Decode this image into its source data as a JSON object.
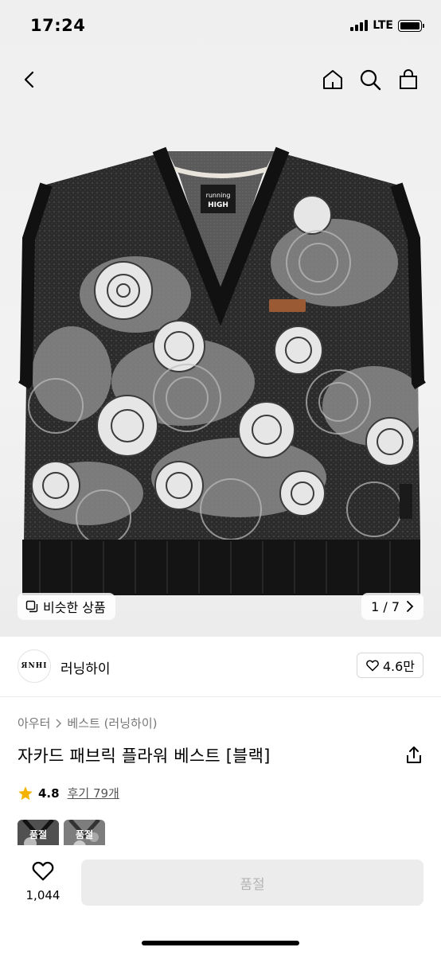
{
  "status_bar": {
    "time": "17:24",
    "network": "LTE"
  },
  "nav": {
    "back_icon": "chevron-left-icon",
    "home_icon": "home-icon",
    "search_icon": "search-icon",
    "cart_icon": "shopping-bag-icon"
  },
  "gallery": {
    "similar_label": "비슷한 상품",
    "counter": "1 / 7",
    "vest_tag_top": "running",
    "vest_tag_bottom": "HIGH"
  },
  "brand": {
    "logo_text": "ЯNHI",
    "name": "러닝하이",
    "likes": "4.6만"
  },
  "product": {
    "breadcrumb": [
      "아우터",
      "베스트 (러닝하이)"
    ],
    "title": "자카드 패브릭 플라워 베스트 [블랙]",
    "rating": "4.8",
    "reviews": "후기 79개",
    "thumb_labels": [
      "품절",
      "품절"
    ]
  },
  "bottom": {
    "wish_count": "1,044",
    "buy_label": "품절"
  },
  "colors": {
    "accent_star": "#F5B301",
    "disabled_bg": "#ECECEC",
    "disabled_text": "#B4B4B4"
  }
}
